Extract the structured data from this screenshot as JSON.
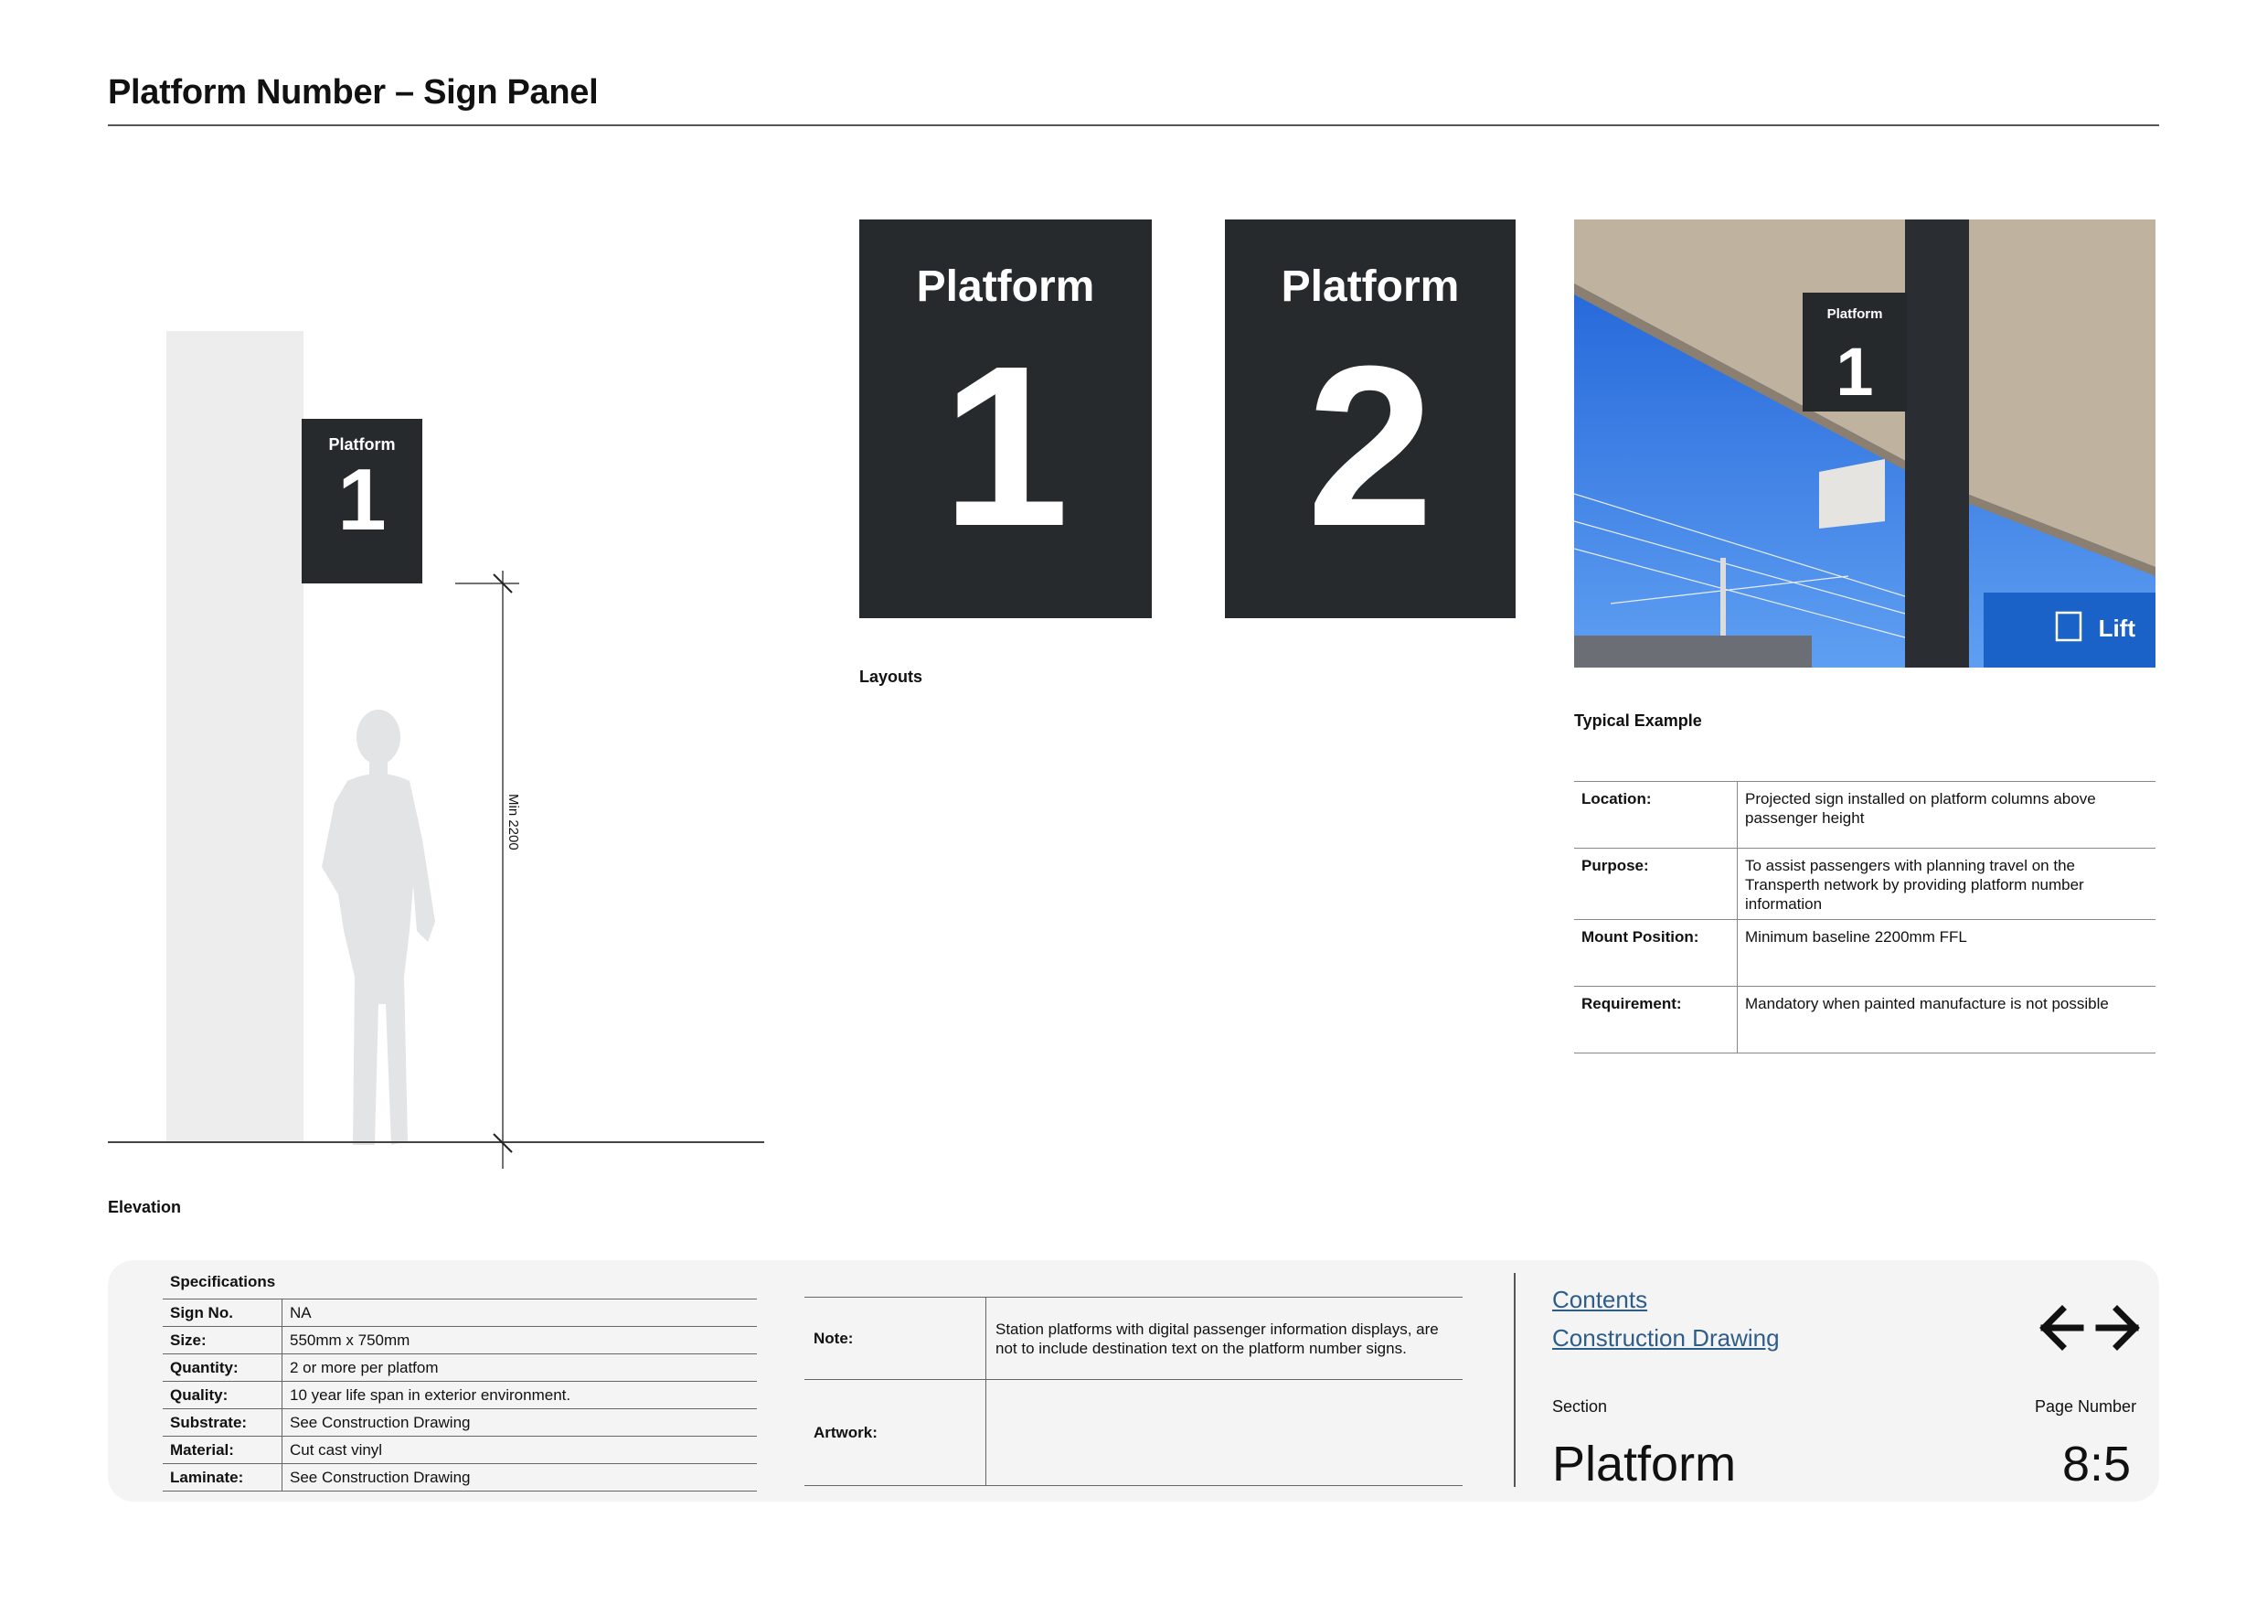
{
  "header": {
    "title": "Platform Number – Sign Panel"
  },
  "elevation": {
    "sign_label": "Platform",
    "sign_number": "1",
    "dimension_label": "Min 2200",
    "caption": "Elevation"
  },
  "layouts": {
    "signs": [
      {
        "label": "Platform",
        "number": "1"
      },
      {
        "label": "Platform",
        "number": "2"
      }
    ],
    "caption": "Layouts"
  },
  "typical_example": {
    "photo_sign_label": "Platform",
    "photo_sign_number": "1",
    "photo_lift_label": "Lift",
    "caption": "Typical Example"
  },
  "info": [
    {
      "key": "Location:",
      "value": "Projected sign installed on platform columns above passenger height"
    },
    {
      "key": "Purpose:",
      "value": "To assist passengers with planning travel on the Transperth network by providing platform number information"
    },
    {
      "key": "Mount Position:",
      "value": "Minimum baseline 2200mm FFL"
    },
    {
      "key": "Requirement:",
      "value": "Mandatory when painted manufacture is not possible"
    }
  ],
  "specifications": {
    "title": "Specifications",
    "rows": [
      {
        "key": "Sign No.",
        "value": "NA"
      },
      {
        "key": "Size:",
        "value": "550mm x 750mm"
      },
      {
        "key": "Quantity:",
        "value": "2 or more per platfom"
      },
      {
        "key": "Quality:",
        "value": "10 year life span in exterior environment."
      },
      {
        "key": "Substrate:",
        "value": "See Construction Drawing"
      },
      {
        "key": "Material:",
        "value": "Cut cast vinyl"
      },
      {
        "key": "Laminate:",
        "value": "See Construction Drawing"
      }
    ]
  },
  "notes": {
    "note_key": "Note:",
    "note_value": "Station platforms with digital passenger information displays, are not to include destination text on the platform number signs.",
    "artwork_key": "Artwork:",
    "artwork_value": ""
  },
  "footer": {
    "links": [
      "Contents",
      "Construction Drawing"
    ],
    "section_label": "Section",
    "section_value": "Platform",
    "page_number_label": "Page Number",
    "page_number_value": "8:5"
  },
  "colors": {
    "sign_dark": "#262a2c",
    "link_blue": "#2e5d8a",
    "panel_grey": "#f4f4f4"
  }
}
